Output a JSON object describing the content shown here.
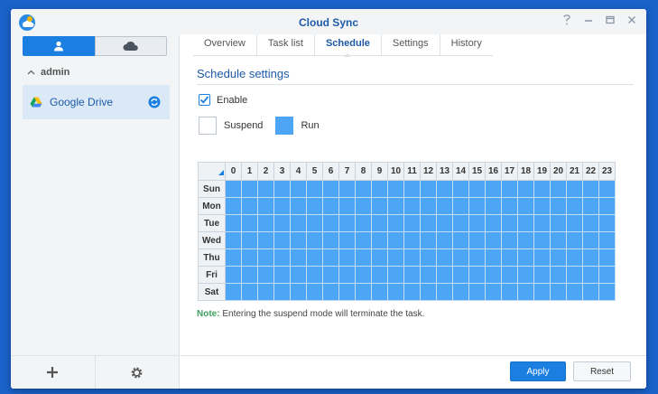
{
  "window": {
    "title": "Cloud Sync",
    "controls": [
      "help-icon",
      "minimize-icon",
      "maximize-icon",
      "close-icon"
    ]
  },
  "sidebar": {
    "toggle": [
      "user-icon",
      "cloud-icon"
    ],
    "user_label": "admin",
    "items": [
      {
        "label": "Google Drive",
        "icon": "google-drive-icon",
        "status_icon": "sync-icon"
      }
    ],
    "footer": [
      "add-icon",
      "gear-icon"
    ]
  },
  "tabs": [
    {
      "label": "Overview",
      "active": false
    },
    {
      "label": "Task list",
      "active": false
    },
    {
      "label": "Schedule",
      "active": true
    },
    {
      "label": "Settings",
      "active": false
    },
    {
      "label": "History",
      "active": false
    }
  ],
  "schedule": {
    "section_title": "Schedule settings",
    "enable_label": "Enable",
    "enabled": true,
    "legend": {
      "suspend_label": "Suspend",
      "run_label": "Run"
    },
    "hours": [
      "0",
      "1",
      "2",
      "3",
      "4",
      "5",
      "6",
      "7",
      "8",
      "9",
      "10",
      "11",
      "12",
      "13",
      "14",
      "15",
      "16",
      "17",
      "18",
      "19",
      "20",
      "21",
      "22",
      "23"
    ],
    "days": [
      "Sun",
      "Mon",
      "Tue",
      "Wed",
      "Thu",
      "Fri",
      "Sat"
    ],
    "state": "Run",
    "note_label": "Note:",
    "note_text": " Entering the suspend mode will terminate the task."
  },
  "buttons": {
    "apply": "Apply",
    "reset": "Reset"
  },
  "colors": {
    "accent": "#1b7fe1",
    "run": "#4da6f5",
    "title": "#1d5aa8",
    "desktop": "#1a62c9"
  }
}
